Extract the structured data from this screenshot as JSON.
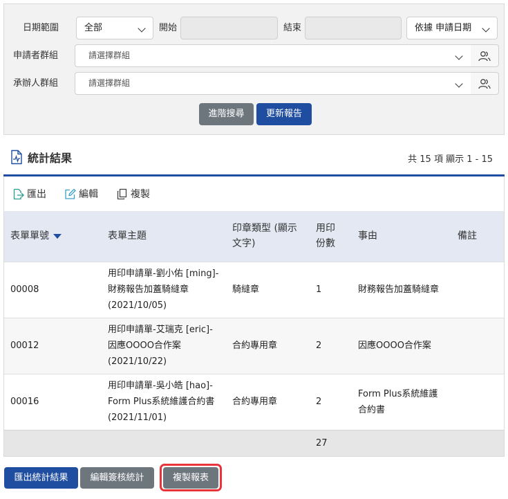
{
  "filters": {
    "date_range_label": "日期範圍",
    "date_range_value": "全部",
    "start_label": "開始",
    "start_value": "",
    "end_label": "結束",
    "end_value": "",
    "date_basis_value": "依據 申請日期",
    "applicant_group_label": "申請者群組",
    "applicant_group_placeholder": "請選擇群組",
    "handler_group_label": "承辦人群組",
    "handler_group_placeholder": "請選擇群組",
    "advanced_search_label": "進階搜尋",
    "update_report_label": "更新報告"
  },
  "results": {
    "title": "統計結果",
    "count_text": "共 15 項 顯示 1 - 15",
    "toolbar": {
      "export_label": "匯出",
      "edit_label": "編輯",
      "copy_label": "複製"
    },
    "columns": {
      "form_no": "表單單號",
      "subject": "表單主題",
      "seal_type_line1": "印章類型 (顯示",
      "seal_type_line2": "文字)",
      "copies_line1": "用印",
      "copies_line2": "份數",
      "reason": "事由",
      "note": "備註"
    },
    "rows": [
      {
        "form_no": "00008",
        "subject_line1": "用印申請單-劉小佑 [ming]-",
        "subject_line2": "財務報告加蓋騎縫章",
        "subject_line3": "(2021/10/05)",
        "seal_type": "騎縫章",
        "copies": "1",
        "reason_line1": "財務報告加蓋騎縫章",
        "reason_line2": "",
        "note": ""
      },
      {
        "form_no": "00012",
        "subject_line1": "用印申請單-艾瑞克 [eric]-",
        "subject_line2": "因應OOOO合作案",
        "subject_line3": "(2021/10/22)",
        "seal_type": "合約專用章",
        "copies": "2",
        "reason_line1": "因應OOOO合作案",
        "reason_line2": "",
        "note": ""
      },
      {
        "form_no": "00016",
        "subject_line1": "用印申請單-吳小皓 [hao]-",
        "subject_line2": "Form Plus系統維護合約書",
        "subject_line3": "(2021/11/01)",
        "seal_type": "合約專用章",
        "copies": "2",
        "reason_line1": "Form Plus系統維護",
        "reason_line2": "合約書",
        "note": ""
      }
    ],
    "total_copies": "27"
  },
  "footer_buttons": {
    "export_stats_label": "匯出統計結果",
    "edit_approval_stats_label": "編輯簽核統計",
    "copy_report_label": "複製報表"
  },
  "colors": {
    "primary": "#1f4ea1",
    "secondary": "#6d757d",
    "highlight": "#e8333a"
  }
}
